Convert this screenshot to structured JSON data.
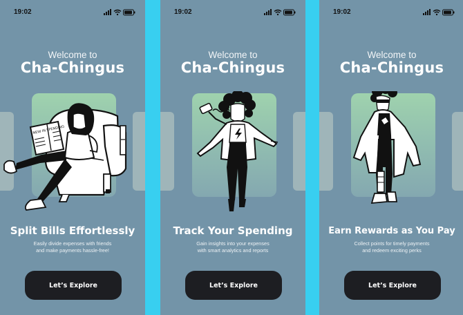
{
  "screens": [
    {
      "time": "19:02",
      "welcome": "Welcome to",
      "brand": "Cha-Chingus",
      "heading": "Split Bills Effortlessly",
      "subtitle_line1": "Easily divide expenses with friends",
      "subtitle_line2": "and make payments hassle-free!",
      "button_label": "Let’s Explore",
      "newspaper_text": "NEW IN SPENDING"
    },
    {
      "time": "19:02",
      "welcome": "Welcome to",
      "brand": "Cha-Chingus",
      "heading": "Track Your Spending",
      "subtitle_line1": "Gain insights into your expenses",
      "subtitle_line2": "with smart analytics and reports",
      "button_label": "Let’s Explore"
    },
    {
      "time": "19:02",
      "welcome": "Welcome to",
      "brand": "Cha-Chingus",
      "heading": "Earn Rewards as You Pay",
      "subtitle_line1": "Collect points for timely payments",
      "subtitle_line2": "and redeem exciting perks",
      "button_label": "Let’s Explore"
    }
  ],
  "icons": [
    "signal-icon",
    "wifi-icon",
    "battery-icon"
  ],
  "colors": {
    "page_bg": "#38cff0",
    "screen_bg": "#7394a8",
    "card_top": "#9fd2ad",
    "card_bottom": "#84a8b0",
    "side_card": "#9fb5b9",
    "button_bg": "#1d1e22",
    "text": "#ffffff"
  }
}
